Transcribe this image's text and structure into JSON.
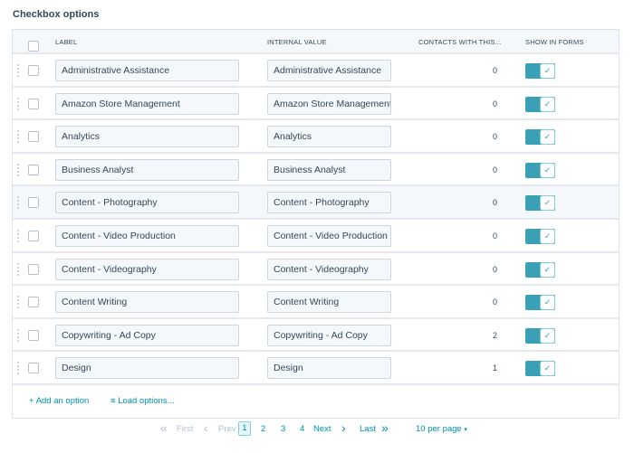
{
  "section_title": "Checkbox options",
  "columns": {
    "label": "LABEL",
    "internal_value": "INTERNAL VALUE",
    "contacts": "CONTACTS WITH THIS...",
    "show_in_forms": "SHOW IN FORMS"
  },
  "rows": [
    {
      "label": "Administrative Assistance",
      "internal_value": "Administrative Assistance",
      "contacts": "0",
      "show_in_forms": true
    },
    {
      "label": "Amazon Store Management",
      "internal_value": "Amazon Store Management",
      "contacts": "0",
      "show_in_forms": true
    },
    {
      "label": "Analytics",
      "internal_value": "Analytics",
      "contacts": "0",
      "show_in_forms": true
    },
    {
      "label": "Business Analyst",
      "internal_value": "Business Analyst",
      "contacts": "0",
      "show_in_forms": true
    },
    {
      "label": "Content - Photography",
      "internal_value": "Content - Photography",
      "contacts": "0",
      "show_in_forms": true
    },
    {
      "label": "Content - Video Production",
      "internal_value": "Content - Video Production",
      "contacts": "0",
      "show_in_forms": true
    },
    {
      "label": "Content - Videography",
      "internal_value": "Content - Videography",
      "contacts": "0",
      "show_in_forms": true
    },
    {
      "label": "Content Writing",
      "internal_value": "Content Writing",
      "contacts": "0",
      "show_in_forms": true
    },
    {
      "label": "Copywriting - Ad Copy",
      "internal_value": "Copywriting - Ad Copy",
      "contacts": "2",
      "show_in_forms": true
    },
    {
      "label": "Design",
      "internal_value": "Design",
      "contacts": "1",
      "show_in_forms": true
    }
  ],
  "footer": {
    "add_option": "Add an option",
    "load_options": "Load options..."
  },
  "pagination": {
    "first": "First",
    "prev": "Prev",
    "pages": [
      "1",
      "2",
      "3",
      "4"
    ],
    "current_page": "1",
    "next": "Next",
    "last": "Last",
    "per_page": "10 per page"
  },
  "icons": {
    "add": "+",
    "list": "≡",
    "check": "✓",
    "first": "«",
    "prev": "‹",
    "next": "›",
    "last": "»",
    "caret": "▾"
  },
  "colors": {
    "accent": "#0091ae",
    "toggle_on": "#3aa0b5"
  }
}
